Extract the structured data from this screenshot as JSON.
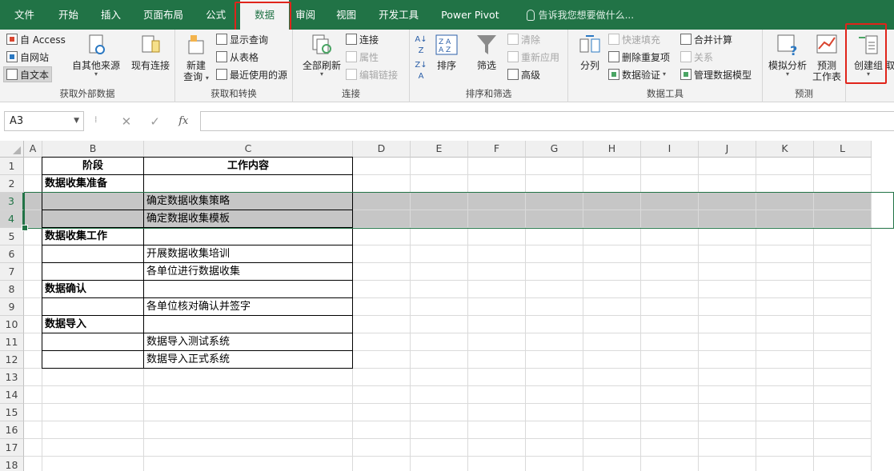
{
  "tabs": [
    "文件",
    "开始",
    "插入",
    "页面布局",
    "公式",
    "数据",
    "审阅",
    "视图",
    "开发工具",
    "Power Pivot"
  ],
  "active_tab": "数据",
  "tell_me": "告诉我您想要做什么...",
  "ribbon": {
    "get_external": {
      "label": "获取外部数据",
      "access": "自 Access",
      "web": "自网站",
      "text": "自文本",
      "other_sources": "自其他来源",
      "existing": "现有连接"
    },
    "get_transform": {
      "label": "获取和转换",
      "new_query_1": "新建",
      "new_query_2": "查询",
      "show_queries": "显示查询",
      "from_table": "从表格",
      "recent_sources": "最近使用的源"
    },
    "connections": {
      "label": "连接",
      "refresh_all": "全部刷新",
      "connections": "连接",
      "properties": "属性",
      "edit_links": "编辑链接"
    },
    "sort_filter": {
      "label": "排序和筛选",
      "sort": "排序",
      "filter": "筛选",
      "clear": "清除",
      "reapply": "重新应用",
      "advanced": "高级"
    },
    "data_tools": {
      "label": "数据工具",
      "text_to_columns": "分列",
      "flash_fill": "快速填充",
      "remove_duplicates": "删除重复项",
      "data_validation": "数据验证",
      "consolidate": "合并计算",
      "relationships": "关系",
      "manage_model": "管理数据模型"
    },
    "forecast": {
      "label": "预测",
      "what_if": "模拟分析",
      "forecast_sheet_1": "预测",
      "forecast_sheet_2": "工作表"
    },
    "outline": {
      "group_btn": "创建组",
      "ungroup_partial": "取"
    }
  },
  "formula_bar": {
    "name_box": "A3",
    "cancel": "✕",
    "enter": "✓",
    "fx": "fx",
    "content": ""
  },
  "columns": [
    "A",
    "B",
    "C",
    "D",
    "E",
    "F",
    "G",
    "H",
    "I",
    "J",
    "K",
    "L"
  ],
  "rows": [
    {
      "n": "1",
      "b": "阶段",
      "c": "工作内容"
    },
    {
      "n": "2",
      "b": "数据收集准备",
      "c": ""
    },
    {
      "n": "3",
      "b": "",
      "c": "确定数据收集策略"
    },
    {
      "n": "4",
      "b": "",
      "c": "确定数据收集模板"
    },
    {
      "n": "5",
      "b": "数据收集工作",
      "c": ""
    },
    {
      "n": "6",
      "b": "",
      "c": "开展数据收集培训"
    },
    {
      "n": "7",
      "b": "",
      "c": "各单位进行数据收集"
    },
    {
      "n": "8",
      "b": "数据确认",
      "c": ""
    },
    {
      "n": "9",
      "b": "",
      "c": "各单位核对确认并签字"
    },
    {
      "n": "10",
      "b": "数据导入",
      "c": ""
    },
    {
      "n": "11",
      "b": "",
      "c": "数据导入测试系统"
    },
    {
      "n": "12",
      "b": "",
      "c": "数据导入正式系统"
    },
    {
      "n": "13",
      "b": "",
      "c": ""
    },
    {
      "n": "14",
      "b": "",
      "c": ""
    },
    {
      "n": "15",
      "b": "",
      "c": ""
    },
    {
      "n": "16",
      "b": "",
      "c": ""
    },
    {
      "n": "17",
      "b": "",
      "c": ""
    },
    {
      "n": "18",
      "b": "",
      "c": ""
    }
  ],
  "selected_rows": [
    "3",
    "4"
  ],
  "accent_color": "#217346",
  "highlight_color": "#e0241a"
}
